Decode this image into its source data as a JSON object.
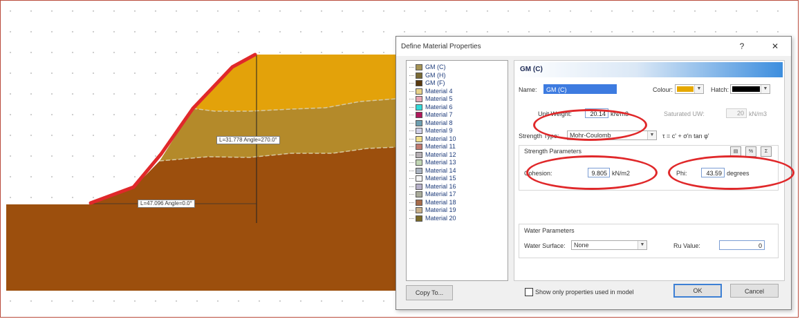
{
  "dialog": {
    "title": "Define Material Properties",
    "help_glyph": "?",
    "close_glyph": "✕",
    "copy_to_label": "Copy To...",
    "ok_label": "OK",
    "cancel_label": "Cancel",
    "show_only_used_label": "Show only properties used in model",
    "show_only_used_checked": false
  },
  "materials": [
    {
      "name": "GM (C)",
      "color": "#a69455"
    },
    {
      "name": "GM (H)",
      "color": "#7a6a35"
    },
    {
      "name": "GM (F)",
      "color": "#5a3a10"
    },
    {
      "name": "Material 4",
      "color": "#e8d28a"
    },
    {
      "name": "Material 5",
      "color": "#e9a5b3"
    },
    {
      "name": "Material 6",
      "color": "#33d9d9"
    },
    {
      "name": "Material 7",
      "color": "#b0185c"
    },
    {
      "name": "Material 8",
      "color": "#6d9fb0"
    },
    {
      "name": "Material 9",
      "color": "#d0d0e6"
    },
    {
      "name": "Material 10",
      "color": "#f2e08a"
    },
    {
      "name": "Material 11",
      "color": "#c07a6f"
    },
    {
      "name": "Material 12",
      "color": "#b6b0b4"
    },
    {
      "name": "Material 13",
      "color": "#c1d6b4"
    },
    {
      "name": "Material 14",
      "color": "#aab3c0"
    },
    {
      "name": "Material 15",
      "color": "#f5f5f5"
    },
    {
      "name": "Material 16",
      "color": "#b7b1c9"
    },
    {
      "name": "Material 17",
      "color": "#a9ab9a"
    },
    {
      "name": "Material 18",
      "color": "#a66b4a"
    },
    {
      "name": "Material 19",
      "color": "#c9b08a"
    },
    {
      "name": "Material 20",
      "color": "#7b6b2a"
    }
  ],
  "properties": {
    "header": "GM (C)",
    "name_label": "Name:",
    "name_value": "GM (C)",
    "colour_label": "Colour:",
    "colour_value": "#e6a800",
    "hatch_label": "Hatch:",
    "hatch_value": "#000000",
    "unit_weight_label": "Unit Weight:",
    "unit_weight_value": "20.14",
    "unit_weight_units": "kN/m3",
    "saturated_label": "Saturated UW:",
    "saturated_value": "20",
    "saturated_units": "kN/m3",
    "strength_type_label": "Strength Type:",
    "strength_type_value": "Mohr-Coulomb",
    "strength_formula": "τ = c' + σ'n tan φ'",
    "strength_params_label": "Strength Parameters",
    "cohesion_label": "Cohesion:",
    "cohesion_value": "9.805",
    "cohesion_units": "kN/m2",
    "phi_label": "Phi:",
    "phi_value": "43.59",
    "phi_units": "degrees",
    "water_params_label": "Water Parameters",
    "water_surface_label": "Water Surface:",
    "water_surface_value": "None",
    "ru_label": "Ru Value:",
    "ru_value": "0"
  },
  "plot": {
    "label_upper": "L=31.778 Angle=270.0°",
    "label_lower": "L=47.096 Angle=0.0°",
    "colors": {
      "layer_top": "#e3a20a",
      "layer_mid": "#b48a2a",
      "layer_bottom": "#9c4f0d",
      "highlight": "#e0282a"
    }
  }
}
